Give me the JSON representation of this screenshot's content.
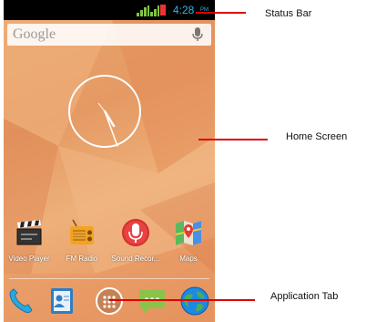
{
  "status_bar": {
    "time": "4:28",
    "ampm": "PM",
    "colors": {
      "signal": "#7ec541",
      "battery": "#e33333",
      "time": "#33b5e5"
    }
  },
  "search": {
    "brand": "Google",
    "icon": "mic-icon"
  },
  "clock_widget": {
    "type": "analog-clock",
    "hour_hand_icon": "clock-hand"
  },
  "apps": [
    {
      "label": "Video Player",
      "icon": "clapperboard-icon"
    },
    {
      "label": "FM Radio",
      "icon": "radio-icon"
    },
    {
      "label": "Sound Recor...",
      "icon": "microphone-icon"
    },
    {
      "label": "Maps",
      "icon": "map-icon"
    }
  ],
  "dock": [
    {
      "icon": "phone-icon"
    },
    {
      "icon": "contacts-icon"
    },
    {
      "icon": "all-apps-icon"
    },
    {
      "icon": "messaging-icon"
    },
    {
      "icon": "browser-globe-icon"
    }
  ],
  "annotations": [
    {
      "label": "Status Bar"
    },
    {
      "label": "Home Screen"
    },
    {
      "label": "Application Tab"
    }
  ],
  "colors": {
    "pointer": "#e00000",
    "wallpaper": "#e9a46d"
  }
}
